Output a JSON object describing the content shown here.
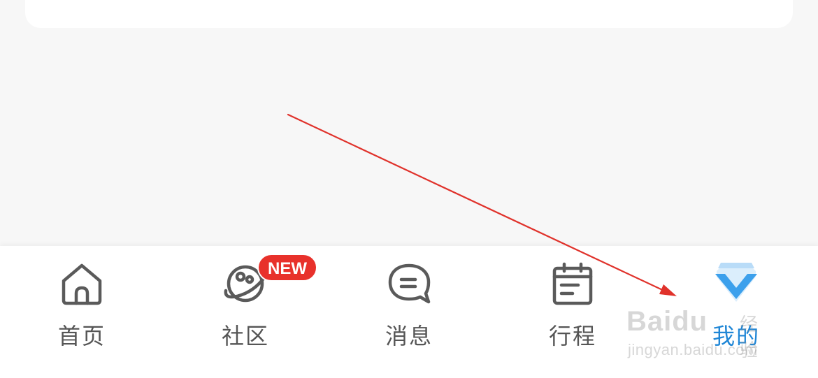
{
  "tabbar": {
    "tabs": [
      {
        "label": "首页",
        "icon": "home-icon",
        "active": false
      },
      {
        "label": "社区",
        "icon": "community-planet-icon",
        "active": false
      },
      {
        "label": "消息",
        "icon": "message-bubble-icon",
        "active": false
      },
      {
        "label": "行程",
        "icon": "calendar-icon",
        "active": false
      },
      {
        "label": "我的",
        "icon": "diamond-v-icon",
        "active": true
      }
    ],
    "badge": "NEW"
  },
  "watermark": {
    "brand": "Baidu",
    "brand_cn": "经验",
    "url": "jingyan.baidu.com"
  },
  "colors": {
    "active": "#1f86d6",
    "inactive": "#555555",
    "badge": "#e8312b",
    "arrow": "#e0322b",
    "background": "#f7f7f7"
  }
}
